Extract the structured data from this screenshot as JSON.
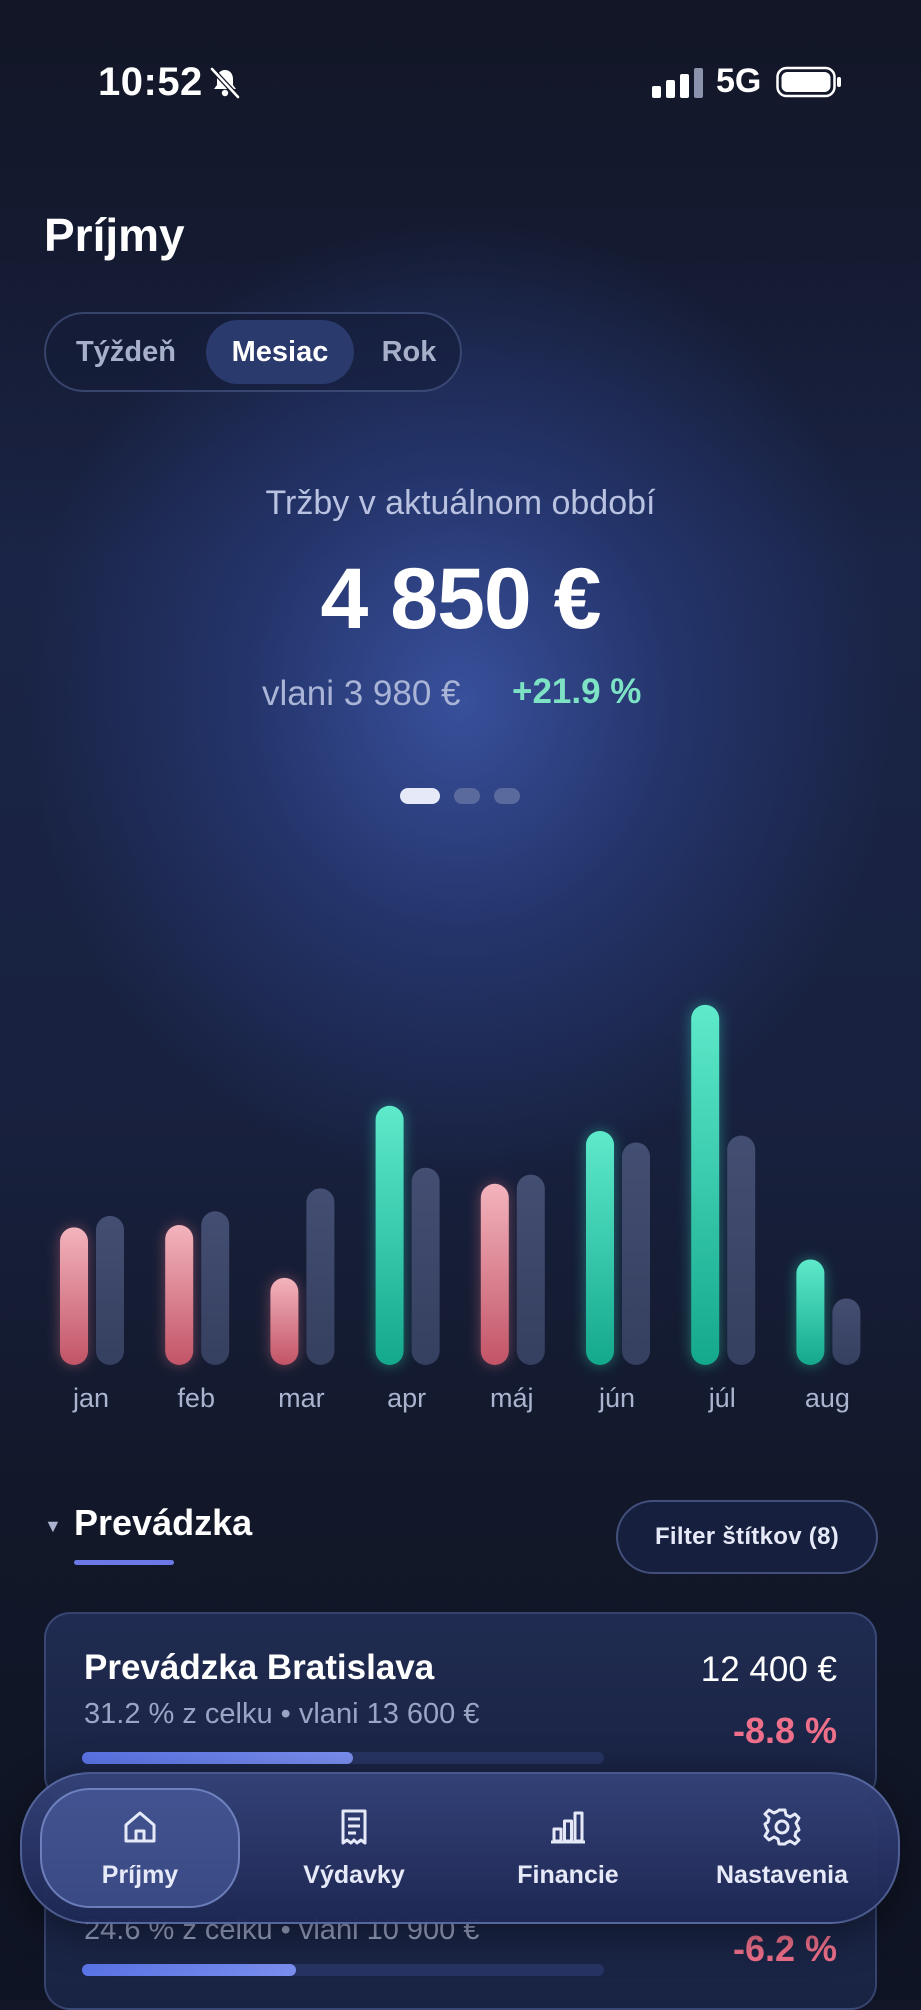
{
  "status_bar": {
    "time": "10:52",
    "network": "5G"
  },
  "header": {
    "title": "Príjmy"
  },
  "period_tabs": [
    {
      "label": "Týždeň",
      "selected": false
    },
    {
      "label": "Mesiac",
      "selected": true
    },
    {
      "label": "Rok",
      "selected": false
    }
  ],
  "summary": {
    "label": "Tržby v aktuálnom období",
    "value": "4 850 €",
    "previous": "vlani 3 980 €",
    "change": "+21.9 %"
  },
  "pager": {
    "count": 3,
    "active_index": 0
  },
  "chart_data": {
    "type": "bar",
    "categories": [
      "jan",
      "feb",
      "mar",
      "apr",
      "máj",
      "jún",
      "júl",
      "aug"
    ],
    "series": [
      {
        "values": [
          3000,
          3050,
          1900,
          5650,
          3950,
          5100,
          7850,
          2300
        ],
        "trend": [
          "down",
          "down",
          "down",
          "up",
          "down",
          "up",
          "up",
          "up"
        ]
      },
      {
        "values": [
          3250,
          3350,
          3850,
          4300,
          4150,
          4850,
          5000,
          1450
        ]
      }
    ],
    "ylim": [
      0,
      8500
    ],
    "colors": {
      "up": "#2fd6b6",
      "down": "#d9707e",
      "previous": "#3b4566"
    }
  },
  "section": {
    "title": "Prevádzka",
    "filter_label": "Filter štítkov (8)"
  },
  "locations": [
    {
      "name": "Prevádzka Bratislava",
      "share": "31.2 % z celku • vlani 13 600 €",
      "amount": "12 400 €",
      "change": "-8.8 %",
      "progress": 0.312
    },
    {
      "name": "",
      "share": "24.6 % z celku • vlani 10 900 €",
      "amount": "",
      "change": "-6.2 %",
      "progress": 0.246
    }
  ],
  "nav": [
    {
      "label": "Príjmy",
      "icon": "home-icon",
      "active": true
    },
    {
      "label": "Výdavky",
      "icon": "receipt-icon",
      "active": false
    },
    {
      "label": "Financie",
      "icon": "bar-chart-icon",
      "active": false
    },
    {
      "label": "Nastavenia",
      "icon": "gear-icon",
      "active": false
    }
  ]
}
